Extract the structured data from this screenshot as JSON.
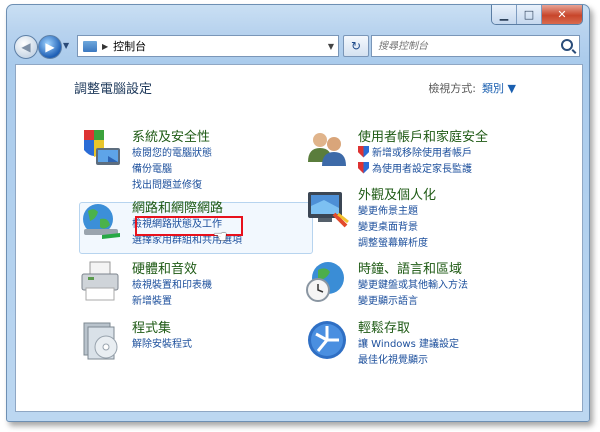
{
  "address": {
    "crumb": "控制台"
  },
  "search": {
    "placeholder": "搜尋控制台"
  },
  "page": {
    "title": "調整電腦設定"
  },
  "viewby": {
    "label": "檢視方式:",
    "value": "類別 ▼"
  },
  "categories": {
    "system": {
      "title": "系統及安全性",
      "links": [
        "檢閱您的電腦狀態",
        "備份電腦",
        "找出問題並修復"
      ]
    },
    "network": {
      "title": "網路和網際網路",
      "links": [
        "檢視網路狀態及工作",
        "選擇家用群組和共用選項"
      ]
    },
    "hardware": {
      "title": "硬體和音效",
      "links": [
        "檢視裝置和印表機",
        "新增裝置"
      ]
    },
    "programs": {
      "title": "程式集",
      "links": [
        "解除安裝程式"
      ]
    },
    "users": {
      "title": "使用者帳戶和家庭安全",
      "links": [
        "新增或移除使用者帳戶",
        "為使用者設定家長監護"
      ]
    },
    "appearance": {
      "title": "外觀及個人化",
      "links": [
        "變更佈景主題",
        "變更桌面背景",
        "調整螢幕解析度"
      ]
    },
    "clock": {
      "title": "時鐘、語言和區域",
      "links": [
        "變更鍵盤或其他輸入方法",
        "變更顯示語言"
      ]
    },
    "ease": {
      "title": "輕鬆存取",
      "links": [
        "讓 Windows 建議設定",
        "最佳化視覺顯示"
      ]
    }
  },
  "colors": {
    "title_green": "#1e5a14",
    "link_blue": "#1c4f9c",
    "highlight_red": "#e8111c"
  }
}
